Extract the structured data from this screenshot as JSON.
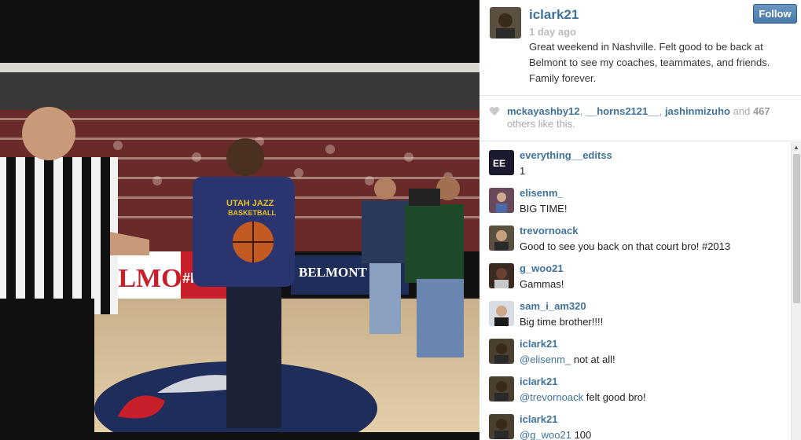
{
  "post": {
    "owner": "iclark21",
    "time_ago": "1 day ago",
    "caption": "Great weekend in Nashville. Felt good to be back at Belmont to see my coaches, teammates, and friends. Family forever.",
    "follow_label": "Follow"
  },
  "likes": {
    "users": [
      "mckayashby12",
      "__horns2121__",
      "jashinmizuho"
    ],
    "and_text": "and",
    "count": "467",
    "suffix": "others like this."
  },
  "photo": {
    "banner_left": "BELMONT",
    "banner_mid": "#ItsB",
    "banner_right": "BELMONT",
    "shirt_text_1": "UTAH JAZZ",
    "shirt_text_2": "BASKETBALL"
  },
  "comments": [
    {
      "user": "everything__editss",
      "text": "1",
      "avatar_color": "#1a1a2e"
    },
    {
      "user": "elisenm_",
      "text": "BIG TIME!",
      "avatar_color": "#6a4a5a"
    },
    {
      "user": "trevornoack",
      "text": "Good to see you back on that court bro! #2013",
      "avatar_color": "#5a5040"
    },
    {
      "user": "g_woo21",
      "text": "Gammas!",
      "avatar_color": "#3a2a20"
    },
    {
      "user": "sam_i_am320",
      "text": "Big time brother!!!!",
      "avatar_color": "#8a9aa8"
    },
    {
      "user": "iclark21",
      "mention": "@elisenm_",
      "text": " not at all!",
      "avatar_color": "#4a4030"
    },
    {
      "user": "iclark21",
      "mention": "@trevornoack",
      "text": " felt good bro!",
      "avatar_color": "#4a4030"
    },
    {
      "user": "iclark21",
      "mention": "@g_woo21",
      "text": " 100",
      "avatar_color": "#4a4030"
    }
  ],
  "colors": {
    "link": "#3f729b",
    "follow": "#4879a8"
  },
  "icons": {
    "like": "heart-icon",
    "scroll_up": "arrow-up-icon"
  }
}
